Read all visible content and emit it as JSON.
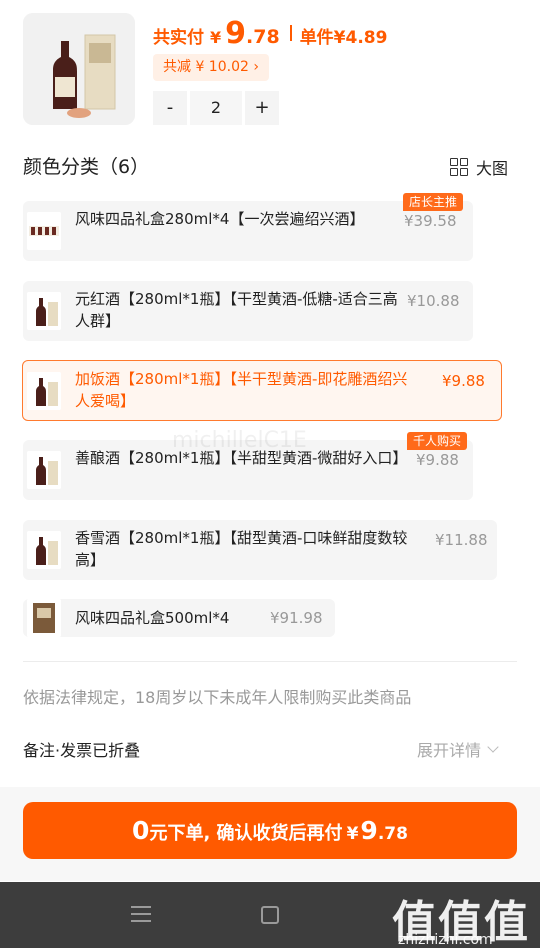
{
  "header": {
    "total_label": "共实付",
    "currency": "¥",
    "total_int": "9",
    "total_dec": ".78",
    "unit_label": "单件¥4.89",
    "discount": "共减 ¥ 10.02 ›",
    "quantity": "2",
    "minus": "-",
    "plus": "+"
  },
  "section": {
    "title": "颜色分类（6）",
    "big_view": "大图"
  },
  "options": [
    {
      "name": "风味四品礼盒280ml*4【一次尝遍绍兴酒】",
      "price": "¥39.58",
      "badge": "店长主推",
      "selected": false
    },
    {
      "name": "元红酒【280ml*1瓶】【干型黄酒-低糖-适合三高人群】",
      "price": "¥10.88",
      "badge": "",
      "selected": false
    },
    {
      "name": "加饭酒【280ml*1瓶】【半干型黄酒-即花雕酒绍兴人爱喝】",
      "price": "¥9.88",
      "badge": "",
      "selected": true
    },
    {
      "name": "善酿酒【280ml*1瓶】【半甜型黄酒-微甜好入口】",
      "price": "¥9.88",
      "badge": "千人购买",
      "selected": false
    },
    {
      "name": "香雪酒【280ml*1瓶】【甜型黄酒-口味鲜甜度数较高】",
      "price": "¥11.88",
      "badge": "",
      "selected": false
    },
    {
      "name": "风味四品礼盒500ml*4",
      "price": "¥91.98",
      "badge": "",
      "selected": false
    }
  ],
  "legal_notice": "依据法律规定，18周岁以下未成年人限制购买此类商品",
  "remark": {
    "label": "备注·发票已折叠",
    "expand": "展开详情"
  },
  "cta": {
    "zero": "0",
    "text": "元下单, 确认收货后再付",
    "currency": "¥",
    "int": "9",
    "dec": ".78"
  },
  "watermark": {
    "text": "值值值",
    "url": "zhizhizhi.com",
    "center": "michillelC1E"
  },
  "colors": {
    "accent": "#ff5a00",
    "badge": "#ff6a1a",
    "navbar": "#3d3d3d"
  }
}
